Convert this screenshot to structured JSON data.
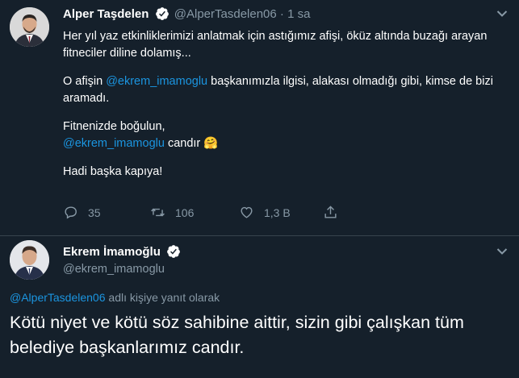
{
  "tweet1": {
    "name": "Alper Taşdelen",
    "handle": "@AlperTasdelen06",
    "dot": "·",
    "time": "1 sa",
    "p1": "Her yıl yaz etkinliklerimizi anlatmak için astığımız afişi, öküz altında buzağı arayan fitneciler diline dolamış...",
    "p2_before": "O afişin ",
    "p2_mention": "@ekrem_imamoglu",
    "p2_after": " başkanımızla ilgisi, alakası olmadığı gibi, kimse de bizi aramadı.",
    "p3_line1": "Fitnenizde boğulun,",
    "p3_mention": "@ekrem_imamoglu",
    "p3_after": " candır 🤗",
    "p4": "Hadi başka kapıya!",
    "replies": "35",
    "retweets": "106",
    "likes": "1,3 B"
  },
  "tweet2": {
    "name": "Ekrem İmamoğlu",
    "handle": "@ekrem_imamoglu",
    "reply_mention": "@AlperTasdelen06",
    "reply_text": " adlı kişiye yanıt olarak",
    "text": "Kötü niyet ve kötü söz sahibine aittir, sizin gibi çalışkan tüm belediye başkanlarımız candır."
  },
  "colors": {
    "background": "#15202b",
    "link": "#1b95e0",
    "muted": "#8899a6",
    "verified": "#ffffff"
  }
}
